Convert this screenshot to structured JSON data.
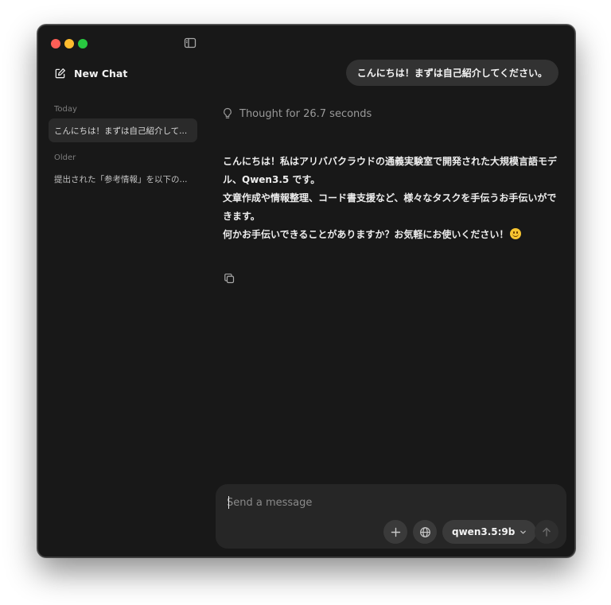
{
  "sidebar": {
    "new_chat_label": "New Chat",
    "sections": [
      {
        "label": "Today",
        "items": [
          "こんにちは！まずは自己紹介して..."
        ]
      },
      {
        "label": "Older",
        "items": [
          "提出された「参考情報」を以下の..."
        ]
      }
    ]
  },
  "conversation": {
    "user_message": "こんにちは！まずは自己紹介してください。",
    "thought_label": "Thought for 26.7 seconds",
    "assistant_lines": [
      "こんにちは！私はアリババクラウドの通義実験室で開発された大規模言語モデル、Qwen3.5 です。",
      "文章作成や情報整理、コード書支援など、様々なタスクを手伝うお手伝いができます。",
      "何かお手伝いできることがありますか？お気軽にお使いください！"
    ],
    "emoji": "smiling-face-emoji"
  },
  "composer": {
    "placeholder": "Send a message",
    "value": "",
    "model": "qwen3.5:9b"
  },
  "colors": {
    "window_bg": "#181818",
    "bubble_bg": "#323232",
    "composer_bg": "#262626"
  }
}
